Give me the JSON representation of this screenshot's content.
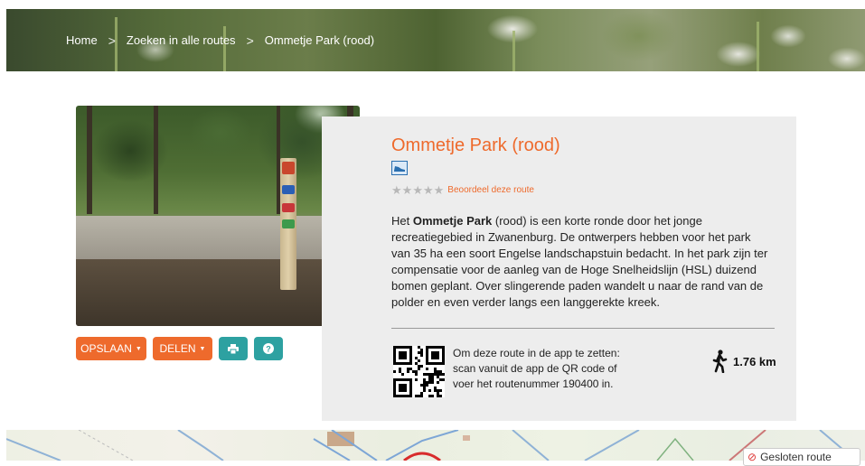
{
  "breadcrumb": {
    "items": [
      "Home",
      "Zoeken in alle routes",
      "Ommetje Park (rood)"
    ],
    "separator": ">"
  },
  "route": {
    "title": "Ommetje Park (rood)",
    "type_icon": "walking-shoe-icon",
    "rating": {
      "stars_filled": 0,
      "stars_total": 5,
      "link": "Beoordeel deze route"
    },
    "description_prefix": "Het ",
    "description_bold": "Ommetje Park",
    "description_rest": " (rood) is een korte ronde door het jonge recreatiegebied in Zwanenburg. De ontwerpers hebben voor het park van 35 ha een soort Engelse landschapstuin bedacht. In het park zijn ter compensatie voor de aanleg van de Hoge Snelheidslijn (HSL) duizend bomen geplant. Over slingerende paden wandelt u naar de rand van de polder en even verder langs een langgerekte kreek.",
    "qr_text": "Om deze route in de app te zetten: scan vanuit de app de QR code of voer het routenummer 190400 in.",
    "distance": "1.76 km"
  },
  "actions": {
    "save_label": "OPSLAAN",
    "share_label": "DELEN",
    "print_icon": "print-icon",
    "help_icon": "question-icon"
  },
  "map": {
    "legend_label": "Gesloten route",
    "legend_icon": "no-entry-icon"
  },
  "colors": {
    "accent": "#ee6a2c",
    "teal": "#2da1a1",
    "panel": "#ededed"
  }
}
